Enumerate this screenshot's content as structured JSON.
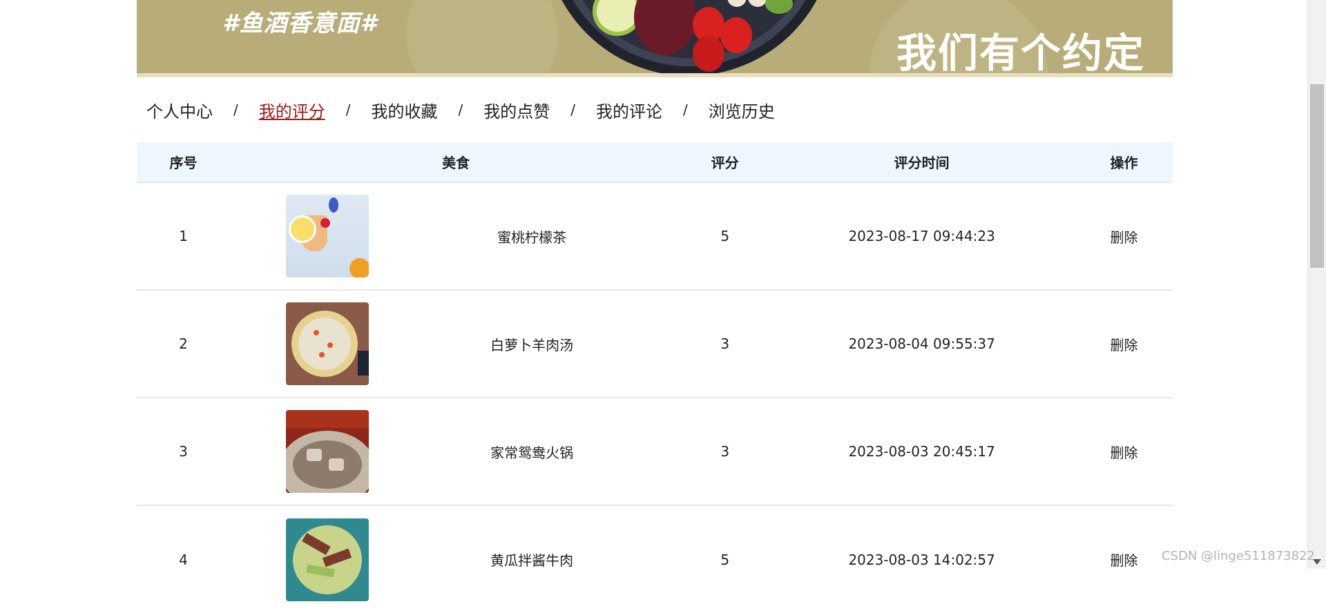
{
  "banner": {
    "tag": "#鱼酒香意面#",
    "slogan": "我们有个约定"
  },
  "breadcrumb": [
    {
      "label": "个人中心",
      "active": false
    },
    {
      "label": "我的评分",
      "active": true
    },
    {
      "label": "我的收藏",
      "active": false
    },
    {
      "label": "我的点赞",
      "active": false
    },
    {
      "label": "我的评论",
      "active": false
    },
    {
      "label": "浏览历史",
      "active": false
    }
  ],
  "breadcrumb_separator": "/",
  "table": {
    "headers": [
      "序号",
      "美食",
      "评分",
      "评分时间",
      "操作"
    ],
    "rows": [
      {
        "index": "1",
        "name": "蜜桃柠檬茶",
        "score": "5",
        "time": "2023-08-17 09:44:23",
        "action": "删除"
      },
      {
        "index": "2",
        "name": "白萝卜羊肉汤",
        "score": "3",
        "time": "2023-08-04 09:55:37",
        "action": "删除"
      },
      {
        "index": "3",
        "name": "家常鸳鸯火锅",
        "score": "3",
        "time": "2023-08-03 20:45:17",
        "action": "删除"
      },
      {
        "index": "4",
        "name": "黄瓜拌酱牛肉",
        "score": "5",
        "time": "2023-08-03 14:02:57",
        "action": "删除"
      }
    ]
  },
  "watermark": "CSDN @linge511873822",
  "colors": {
    "banner_bg": "#b8ad79",
    "active_link": "#9b1b1b",
    "header_bg": "#eef7ff"
  }
}
